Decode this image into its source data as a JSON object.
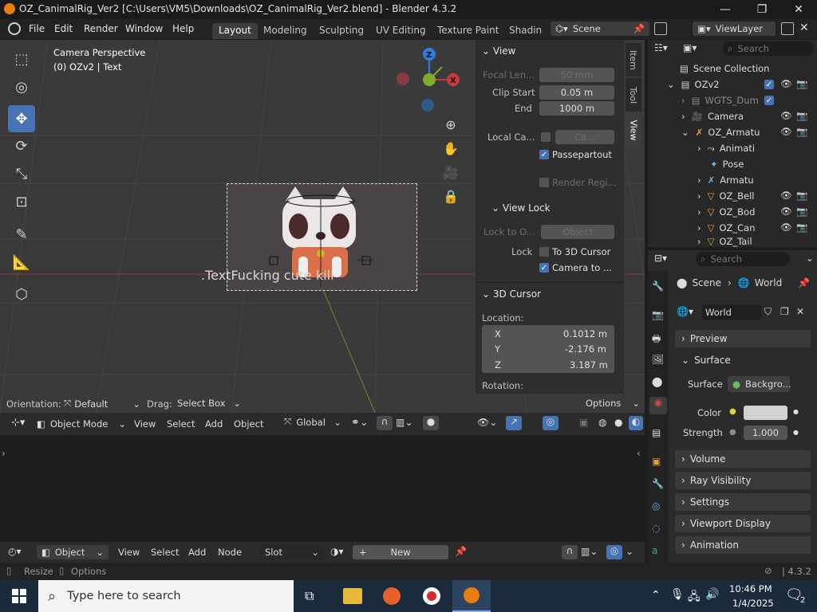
{
  "window": {
    "title": "OZ_CanimalRig_Ver2 [C:\\Users\\VM5\\Downloads\\OZ_CanimalRig_Ver2.blend] - Blender 4.3.2",
    "minimize": "—",
    "maximize": "❐",
    "close": "✕"
  },
  "menu": {
    "items": [
      "File",
      "Edit",
      "Render",
      "Window",
      "Help"
    ]
  },
  "workspaces": {
    "tabs": [
      "Layout",
      "Modeling",
      "Sculpting",
      "UV Editing",
      "Texture Paint",
      "Shading"
    ],
    "active": "Layout"
  },
  "scene_selector": {
    "label": "Scene"
  },
  "viewlayer_selector": {
    "label": "ViewLayer"
  },
  "viewport": {
    "camera_label": "Camera Perspective",
    "object_label": "(0) OZv2 | Text",
    "scene_text": ".TextFucking cute kill",
    "gizmo": {
      "z": "Z",
      "x": "X"
    }
  },
  "npanel": {
    "view_header": "View",
    "focal_length_label": "Focal Len...",
    "focal_length_value": "50 mm",
    "clip_start_label": "Clip Start",
    "clip_start_value": "0.05 m",
    "end_label": "End",
    "end_value": "1000 m",
    "local_camera_label": "Local Ca...",
    "local_camera_value": "Ca...",
    "passepartout_label": "Passepartout",
    "render_region_label": "Render Regi...",
    "view_lock_header": "View Lock",
    "lock_to_object_label": "Lock to O...",
    "lock_to_object_value": "Object",
    "lock_label": "Lock",
    "to_3d_cursor_label": "To 3D Cursor",
    "camera_to_view_label": "Camera to ...",
    "cursor_header": "3D Cursor",
    "location_label": "Location:",
    "x_label": "X",
    "x_value": "0.1012 m",
    "y_label": "Y",
    "y_value": "-2.176 m",
    "z_label": "Z",
    "z_value": "3.187 m",
    "rotation_label": "Rotation:",
    "tabs": [
      "Item",
      "Tool",
      "View"
    ]
  },
  "viewport_bottom": {
    "orientation_label": "Orientation:",
    "orientation_value": "Default",
    "drag_label": "Drag:",
    "drag_value": "Select Box",
    "options": "Options"
  },
  "viewport_header": {
    "mode": "Object Mode",
    "menus": [
      "View",
      "Select",
      "Add",
      "Object"
    ],
    "transform": "Global"
  },
  "outliner": {
    "search_placeholder": "Search",
    "rows": [
      {
        "name": "Scene Collection",
        "indent": 0,
        "icon": "collection-icon"
      },
      {
        "name": "OZv2",
        "indent": 1,
        "icon": "collection-icon"
      },
      {
        "name": "WGTS_Dum",
        "indent": 2,
        "icon": "collection-icon"
      },
      {
        "name": "Camera",
        "indent": 2,
        "icon": "camera-icon"
      },
      {
        "name": "OZ_Armatu",
        "indent": 2,
        "icon": "armature-icon"
      },
      {
        "name": "Animati",
        "indent": 3,
        "icon": "action-icon"
      },
      {
        "name": "Pose",
        "indent": 3,
        "icon": "pose-icon"
      },
      {
        "name": "Armatu",
        "indent": 3,
        "icon": "armature-icon"
      },
      {
        "name": "OZ_Bell",
        "indent": 3,
        "icon": "mesh-icon"
      },
      {
        "name": "OZ_Bod",
        "indent": 3,
        "icon": "mesh-icon"
      },
      {
        "name": "OZ_Can",
        "indent": 3,
        "icon": "mesh-icon"
      },
      {
        "name": "OZ_Tail",
        "indent": 3,
        "icon": "mesh-icon"
      }
    ]
  },
  "properties": {
    "search_placeholder": "Search",
    "breadcrumb_scene": "Scene",
    "breadcrumb_world": "World",
    "world_name": "World",
    "panels": [
      "Preview",
      "Surface",
      "Volume",
      "Ray Visibility",
      "Settings",
      "Viewport Display",
      "Animation"
    ],
    "surface_label": "Surface",
    "surface_value": "Backgro...",
    "color_label": "Color",
    "strength_label": "Strength",
    "strength_value": "1.000",
    "color_swatch": "#d2d2d2"
  },
  "shader_header": {
    "type": "Object",
    "menus": [
      "View",
      "Select",
      "Add",
      "Node"
    ],
    "slot": "Slot",
    "new_button": "New"
  },
  "statusbar": {
    "resize": "Resize",
    "options": "Options",
    "version": "4.3.2"
  },
  "taskbar": {
    "search_placeholder": "Type here to search",
    "time": "10:46 PM",
    "date": "1/4/2025",
    "notification_count": "2"
  },
  "colors": {
    "accent": "#4772b3",
    "x_axis": "#c83a3a",
    "y_axis": "#7faa2a",
    "z_axis": "#2c7fd8"
  }
}
